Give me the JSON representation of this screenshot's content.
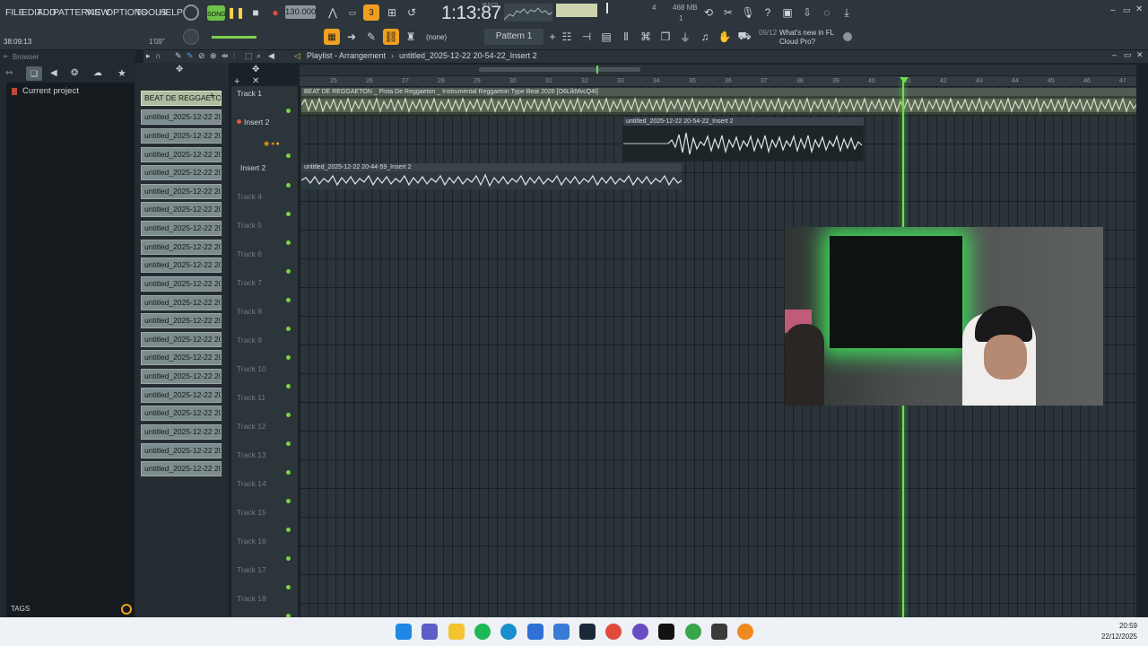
{
  "menu": [
    "FILE",
    "EDIT",
    "ADD",
    "PATTERNS",
    "VIEW",
    "OPTIONS",
    "TOOLS",
    "HELP"
  ],
  "transport": {
    "mode_label": "SONG",
    "tempo": "130.000",
    "time": "1:13:87",
    "time_unit": "M:S:CS",
    "memory": "468 MB",
    "cpu_num1": "4",
    "cpu_num2": "1",
    "elapsed": "38:09:13",
    "pos_small": "1'09\""
  },
  "pattern": {
    "none_label": "(none)",
    "pattern_label": "Pattern 1"
  },
  "news": {
    "date": "09/12",
    "text": "What's new in FL Cloud Pro?"
  },
  "browser": {
    "title": "Browser",
    "current_project": "Current project",
    "tags_label": "TAGS"
  },
  "playlist": {
    "title": "Playlist - Arrangement",
    "breadcrumb": "untitled_2025-12-22 20-54-22_Insert 2"
  },
  "clips_panel": {
    "first": "BEAT DE REGGAETON...",
    "items": [
      "untitled_2025-12-22 20-...",
      "untitled_2025-12-22 20-...",
      "untitled_2025-12-22 20-...",
      "untitled_2025-12-22 20-...",
      "untitled_2025-12-22 20-...",
      "untitled_2025-12-22 20-...",
      "untitled_2025-12-22 20-...",
      "untitled_2025-12-22 20-...",
      "untitled_2025-12-22 20-...",
      "untitled_2025-12-22 20-...",
      "untitled_2025-12-22 20-...",
      "untitled_2025-12-22 20-...",
      "untitled_2025-12-22 20-...",
      "untitled_2025-12-22 20-...",
      "untitled_2025-12-22 20-...",
      "untitled_2025-12-22 20-...",
      "untitled_2025-12-22 20-...",
      "untitled_2025-12-22 20-...",
      "untitled_2025-12-22 20-...",
      "untitled_2025-12-22 20-..."
    ]
  },
  "tracks": [
    "Track 1",
    "Insert 2",
    "Insert 2",
    "Track 4",
    "Track 5",
    "Track 6",
    "Track 7",
    "Track 8",
    "Track 9",
    "Track 10",
    "Track 11",
    "Track 12",
    "Track 13",
    "Track 14",
    "Track 15",
    "Track 16",
    "Track 17",
    "Track 18"
  ],
  "ruler": [
    "25",
    "26",
    "27",
    "28",
    "29",
    "30",
    "31",
    "32",
    "33",
    "34",
    "35",
    "36",
    "37",
    "38",
    "39",
    "40",
    "41",
    "42",
    "43",
    "44",
    "45",
    "46",
    "47"
  ],
  "audio_clips": {
    "beat": "BEAT DE REGGAETON _ Pista De Reggaeton _ Instrumental Reggaeton Type Beat 2026 [O6LikMvcQ4I]",
    "insert_a": "untitled_2025-12-22 20-54-22_Insert 2",
    "insert_b": "untitled_2025-12-22 20-44-59_Insert 2"
  },
  "taskbar": {
    "time": "20:59",
    "date": "22/12/2025"
  },
  "colors": {
    "accent_green": "#6ee04a",
    "orange": "#f0a020"
  }
}
